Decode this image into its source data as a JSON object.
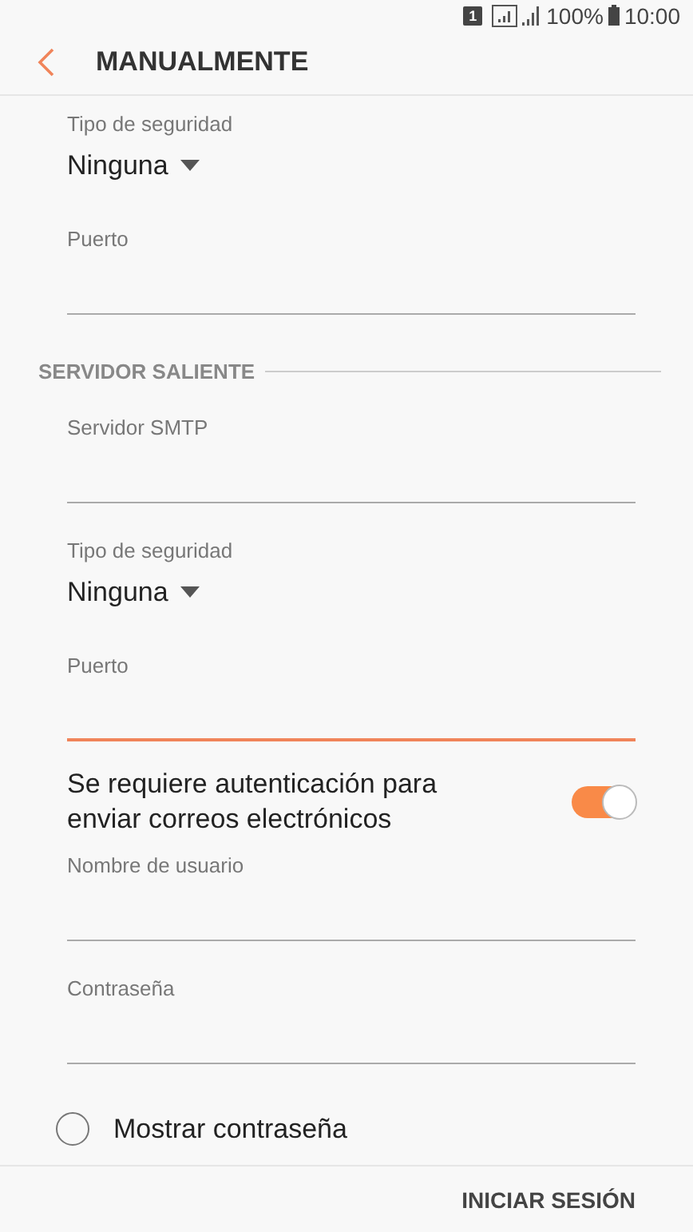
{
  "status_bar": {
    "sim": "1",
    "battery": "100%",
    "time": "10:00"
  },
  "header": {
    "title": "MANUALMENTE"
  },
  "items": [
    {
      "kind": "dropdown",
      "label": "Tipo de seguridad",
      "value": "Ninguna"
    },
    {
      "kind": "field",
      "label": "Puerto",
      "focused": false
    },
    {
      "kind": "section",
      "title": "SERVIDOR SALIENTE"
    },
    {
      "kind": "field",
      "label": "Servidor SMTP",
      "focused": false
    },
    {
      "kind": "dropdown",
      "label": "Tipo de seguridad",
      "value": "Ninguna"
    },
    {
      "kind": "field",
      "label": "Puerto",
      "focused": true
    },
    {
      "kind": "toggle",
      "label": "Se requiere autenticación para enviar correos electrónicos",
      "on": true
    },
    {
      "kind": "field",
      "label": "Nombre de usuario",
      "focused": false
    },
    {
      "kind": "field",
      "label": "Contraseña",
      "focused": false
    },
    {
      "kind": "checkbox",
      "label": "Mostrar contraseña",
      "checked": false
    }
  ],
  "footer": {
    "button": "INICIAR SESIÓN"
  }
}
